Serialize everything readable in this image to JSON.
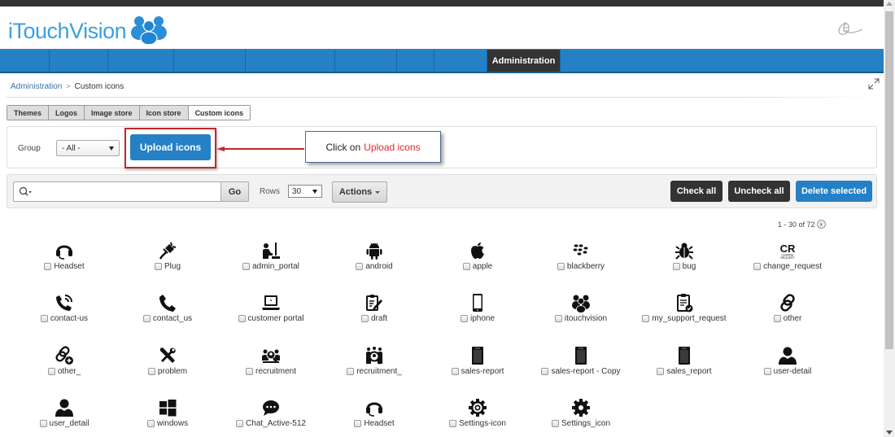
{
  "app": {
    "logo_text": "iTouchVision"
  },
  "navbar": {
    "items": [
      {
        "label": "",
        "active": false
      },
      {
        "label": "",
        "active": false
      },
      {
        "label": "",
        "active": false
      },
      {
        "label": "",
        "active": false
      },
      {
        "label": "",
        "active": false
      },
      {
        "label": "",
        "active": false
      },
      {
        "label": "",
        "active": false
      },
      {
        "label": "",
        "active": false
      },
      {
        "label": "Administration",
        "active": true
      }
    ]
  },
  "breadcrumb": {
    "parent": "Administration",
    "separator": ">",
    "current": "Custom icons"
  },
  "tabs": [
    {
      "label": "Themes",
      "active": false
    },
    {
      "label": "Logos",
      "active": false
    },
    {
      "label": "Image store",
      "active": false
    },
    {
      "label": "Icon store",
      "active": false
    },
    {
      "label": "Custom icons",
      "active": true
    }
  ],
  "filter": {
    "group_label": "Group",
    "group_value": "- All -",
    "upload_button": "Upload icons"
  },
  "callout": {
    "prefix": "Click on",
    "highlight": "Upload icons"
  },
  "toolbar": {
    "search_value": "",
    "go_label": "Go",
    "rows_label": "Rows",
    "rows_value": "30",
    "actions_label": "Actions",
    "check_all": "Check all",
    "uncheck_all": "Uncheck all",
    "delete_selected": "Delete selected"
  },
  "pager": {
    "text": "1 - 30 of 72",
    "next_icon": "chevron-right-circle-icon"
  },
  "icons": [
    {
      "label": "Headset",
      "icon": "headset"
    },
    {
      "label": "Plug",
      "icon": "plug"
    },
    {
      "label": "admin_portal",
      "icon": "admin"
    },
    {
      "label": "android",
      "icon": "android"
    },
    {
      "label": "apple",
      "icon": "apple"
    },
    {
      "label": "blackberry",
      "icon": "blackberry"
    },
    {
      "label": "bug",
      "icon": "bug"
    },
    {
      "label": "change_request",
      "icon": "cr"
    },
    {
      "label": "contact-us",
      "icon": "phone-ring"
    },
    {
      "label": "contact_us",
      "icon": "phone"
    },
    {
      "label": "customer portal",
      "icon": "laptop"
    },
    {
      "label": "draft",
      "icon": "draft"
    },
    {
      "label": "iphone",
      "icon": "iphone"
    },
    {
      "label": "itouchvision",
      "icon": "people"
    },
    {
      "label": "my_support_request",
      "icon": "clipboard-check"
    },
    {
      "label": "other",
      "icon": "link"
    },
    {
      "label": "other_",
      "icon": "link-plus"
    },
    {
      "label": "problem",
      "icon": "tools"
    },
    {
      "label": "recruitment",
      "icon": "recruit"
    },
    {
      "label": "recruitment_",
      "icon": "recruit2"
    },
    {
      "label": "sales-report",
      "icon": "report"
    },
    {
      "label": "sales-report - Copy",
      "icon": "report"
    },
    {
      "label": "sales_report",
      "icon": "report"
    },
    {
      "label": "user-detail",
      "icon": "user"
    },
    {
      "label": "user_detail",
      "icon": "user"
    },
    {
      "label": "windows",
      "icon": "windows"
    },
    {
      "label": "Chat_Active-512",
      "icon": "chat"
    },
    {
      "label": "Headset",
      "icon": "headset"
    },
    {
      "label": "Settings-icon",
      "icon": "gear-ring"
    },
    {
      "label": "Settings_icon",
      "icon": "gear"
    }
  ]
}
